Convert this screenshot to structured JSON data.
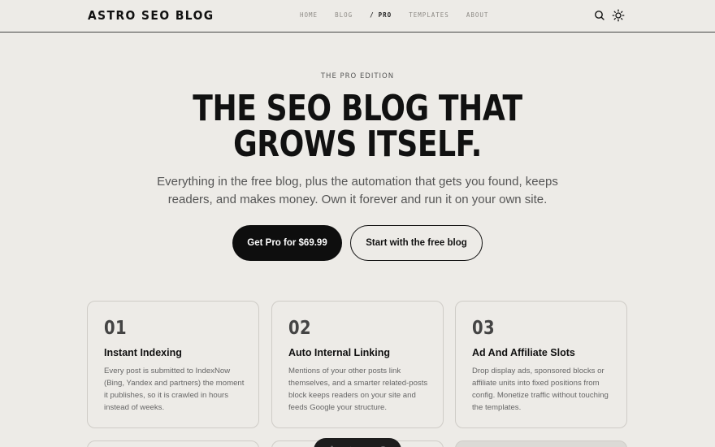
{
  "header": {
    "logo": "ASTRO SEO BLOG",
    "nav": [
      {
        "label": "HOME",
        "active": false
      },
      {
        "label": "BLOG",
        "active": false
      },
      {
        "label": "PRO",
        "active": true
      },
      {
        "label": "TEMPLATES",
        "active": false
      },
      {
        "label": "ABOUT",
        "active": false
      }
    ],
    "active_prefix": "/",
    "icons": [
      "search-icon",
      "sun-icon"
    ]
  },
  "hero": {
    "eyebrow": "THE PRO EDITION",
    "title": "THE SEO BLOG THAT GROWS ITSELF.",
    "subtitle": "Everything in the free blog, plus the automation that gets you found, keeps readers, and makes money. Own it forever and run it on your own site.",
    "primary_cta": "Get Pro for $69.99",
    "secondary_cta": "Start with the free blog"
  },
  "features": [
    {
      "number": "01",
      "title": "Instant Indexing",
      "body": "Every post is submitted to IndexNow (Bing, Yandex and partners) the moment it publishes, so it is crawled in hours instead of weeks."
    },
    {
      "number": "02",
      "title": "Auto Internal Linking",
      "body": "Mentions of your other posts link themselves, and a smarter related-posts block keeps readers on your site and feeds Google your structure."
    },
    {
      "number": "03",
      "title": "Ad And Affiliate Slots",
      "body": "Drop display ads, sponsored blocks or affiliate units into fixed positions from config. Monetize traffic without touching the templates."
    }
  ],
  "colors": {
    "background": "#edebe7",
    "primary_button": "#0e0e0e",
    "text": "#111111",
    "muted_text": "#666666"
  }
}
